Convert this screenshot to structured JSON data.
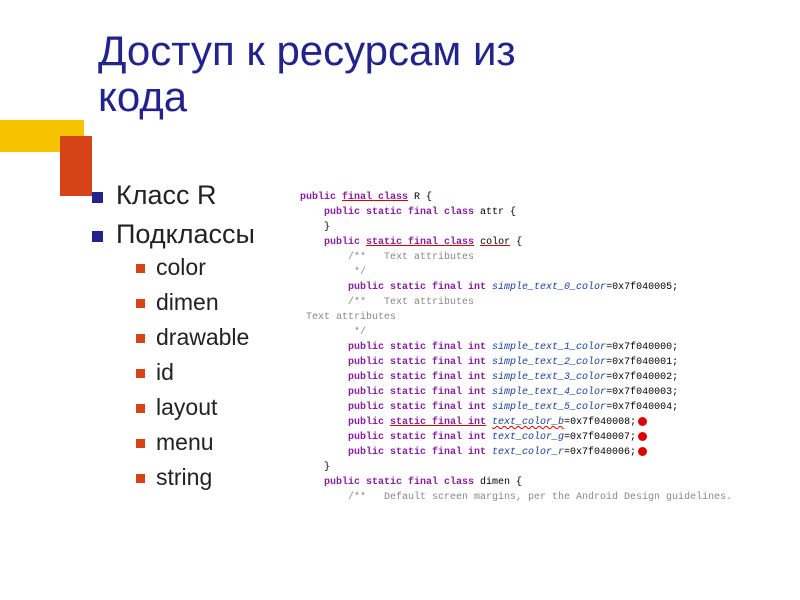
{
  "title_line1": "Доступ к ресурсам из",
  "title_line2": "кода",
  "bullets": {
    "b1": "Класс R",
    "b2": "Подклассы",
    "sub": {
      "s1": "color",
      "s2": "dimen",
      "s3": "drawable",
      "s4": "id",
      "s5": "layout",
      "s6": "menu",
      "s7": "string"
    }
  },
  "code": {
    "l01a": "public ",
    "l01b": "final class",
    "l01c": " R {",
    "l02a": "    public static final class ",
    "l02b": "attr",
    "l02c": " {",
    "l03": "    }",
    "l04a": "    public ",
    "l04b": "static final class",
    "l04c": " ",
    "l04d": "color",
    "l04e": " {",
    "l05": "        /**   Text attributes",
    "l06": "         */",
    "l07a": "        public static final int ",
    "l07b": "simple_text_0_color",
    "l07c": "=0x7f040005;",
    "l08": "        /**   Text attributes",
    "l09": " Text attributes",
    "l10": "         */",
    "l11a": "        public static final int ",
    "l11b": "simple_text_1_color",
    "l11c": "=0x7f040000;",
    "l12a": "        public static final int ",
    "l12b": "simple_text_2_color",
    "l12c": "=0x7f040001;",
    "l13a": "        public static final int ",
    "l13b": "simple_text_3_color",
    "l13c": "=0x7f040002;",
    "l14a": "        public static final int ",
    "l14b": "simple_text_4_color",
    "l14c": "=0x7f040003;",
    "l15a": "        public static final int ",
    "l15b": "simple_text_5_color",
    "l15c": "=0x7f040004;",
    "l16a": "        public ",
    "l16b": "static final int",
    "l16c": " ",
    "l16d": "text_color_b",
    "l16e": "=0x7f040008;",
    "l17a": "        public static final int ",
    "l17b": "text_color_g",
    "l17c": "=0x7f040007;",
    "l18a": "        public static final int ",
    "l18b": "text_color_r",
    "l18c": "=0x7f040006;",
    "l19": "    }",
    "l20a": "    public static final class ",
    "l20b": "dimen",
    "l20c": " {",
    "l21": "        /**   Default screen margins, per the Android Design guidelines."
  }
}
